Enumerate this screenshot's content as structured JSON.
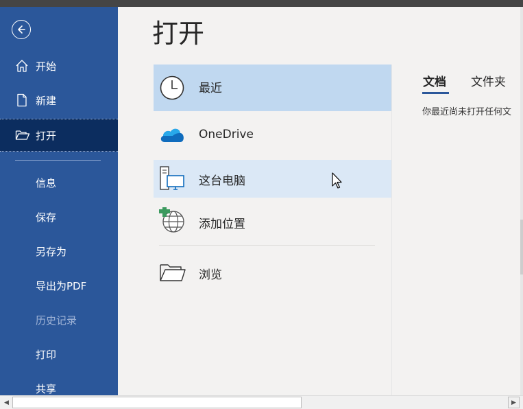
{
  "sidebar": {
    "back_icon": "back-arrow-icon",
    "items": [
      {
        "label": "开始",
        "icon": "home-icon"
      },
      {
        "label": "新建",
        "icon": "new-document-icon"
      },
      {
        "label": "打开",
        "icon": "open-folder-icon"
      },
      {
        "label": "信息"
      },
      {
        "label": "保存"
      },
      {
        "label": "另存为"
      },
      {
        "label": "导出为PDF"
      },
      {
        "label": "历史记录"
      },
      {
        "label": "打印"
      },
      {
        "label": "共享"
      }
    ]
  },
  "main": {
    "title": "打开",
    "locations": [
      {
        "label": "最近",
        "icon": "clock-icon"
      },
      {
        "label": "OneDrive",
        "icon": "onedrive-cloud-icon"
      },
      {
        "label": "这台电脑",
        "icon": "this-pc-icon"
      },
      {
        "label": "添加位置",
        "icon": "add-place-globe-icon"
      },
      {
        "label": "浏览",
        "icon": "browse-folder-icon"
      }
    ],
    "tabs": [
      {
        "label": "文档"
      },
      {
        "label": "文件夹"
      }
    ],
    "empty_message": "你最近尚未打开任何文"
  },
  "colors": {
    "sidebar_bg": "#2b579a",
    "sidebar_active": "#0c2d5f",
    "selected_row": "#c0d8f0",
    "hover_row": "#dbe8f6",
    "accent": "#2b579a"
  }
}
